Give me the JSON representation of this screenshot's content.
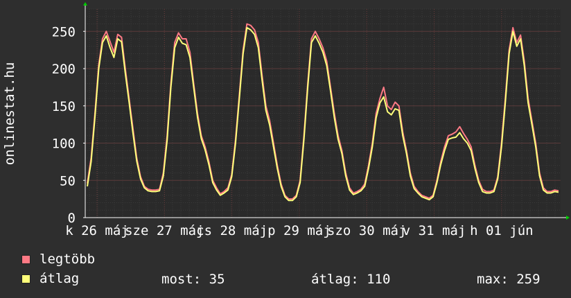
{
  "chart_data": {
    "type": "line",
    "ylabel": "onlinestat.hu",
    "yticks": [
      0,
      50,
      100,
      150,
      200,
      250
    ],
    "ylim": [
      0,
      280
    ],
    "x_tick_labels": [
      "k 26 máj",
      "sze 27 máj",
      "cs 28 máj",
      "p 29 máj",
      "szo 30 máj",
      "v 31 máj",
      "h 01 jún"
    ],
    "grid": true,
    "series": [
      {
        "name": "legtöbb",
        "color": "#ff7a85",
        "values": [
          46,
          80,
          140,
          205,
          240,
          250,
          236,
          222,
          246,
          242,
          200,
          160,
          120,
          80,
          55,
          42,
          38,
          37,
          37,
          38,
          60,
          110,
          180,
          235,
          248,
          240,
          240,
          222,
          180,
          140,
          110,
          95,
          75,
          50,
          40,
          32,
          35,
          40,
          58,
          105,
          165,
          225,
          260,
          258,
          252,
          235,
          190,
          150,
          130,
          100,
          70,
          45,
          30,
          25,
          25,
          30,
          50,
          110,
          180,
          240,
          250,
          240,
          228,
          210,
          175,
          140,
          110,
          90,
          60,
          40,
          33,
          35,
          38,
          45,
          70,
          100,
          140,
          160,
          175,
          150,
          145,
          155,
          150,
          115,
          90,
          60,
          42,
          35,
          30,
          28,
          26,
          30,
          50,
          75,
          95,
          110,
          112,
          115,
          122,
          113,
          105,
          95,
          70,
          50,
          38,
          35,
          35,
          37,
          55,
          100,
          160,
          225,
          255,
          235,
          245,
          210,
          160,
          130,
          100,
          60,
          40,
          35,
          35,
          37,
          36
        ],
        "values_note": "legtöbb (max) series, sampled uniformly over the time axis"
      },
      {
        "name": "átlag",
        "color": "#ffff7a",
        "values": [
          42,
          75,
          135,
          200,
          235,
          244,
          228,
          215,
          240,
          236,
          194,
          155,
          114,
          76,
          52,
          40,
          36,
          35,
          35,
          36,
          56,
          104,
          175,
          228,
          242,
          234,
          232,
          215,
          175,
          135,
          106,
          91,
          71,
          47,
          37,
          30,
          33,
          37,
          55,
          100,
          160,
          220,
          255,
          252,
          246,
          228,
          184,
          144,
          124,
          95,
          66,
          42,
          28,
          23,
          23,
          28,
          47,
          105,
          175,
          235,
          244,
          234,
          222,
          204,
          170,
          134,
          105,
          86,
          56,
          37,
          31,
          33,
          36,
          42,
          66,
          95,
          134,
          154,
          162,
          142,
          138,
          146,
          144,
          110,
          86,
          56,
          39,
          33,
          28,
          26,
          24,
          28,
          47,
          71,
          90,
          105,
          107,
          108,
          114,
          106,
          100,
          90,
          66,
          47,
          35,
          33,
          33,
          35,
          52,
          95,
          154,
          220,
          250,
          230,
          240,
          204,
          154,
          125,
          95,
          56,
          37,
          33,
          33,
          35,
          34
        ]
      }
    ]
  },
  "legend": {
    "items": [
      {
        "label": "legtöbb",
        "color": "#ff7a85"
      },
      {
        "label": "átlag",
        "color": "#ffff7a"
      }
    ]
  },
  "stats": {
    "now": "most: 35",
    "avg": "átlag: 110",
    "max": "max: 259"
  }
}
